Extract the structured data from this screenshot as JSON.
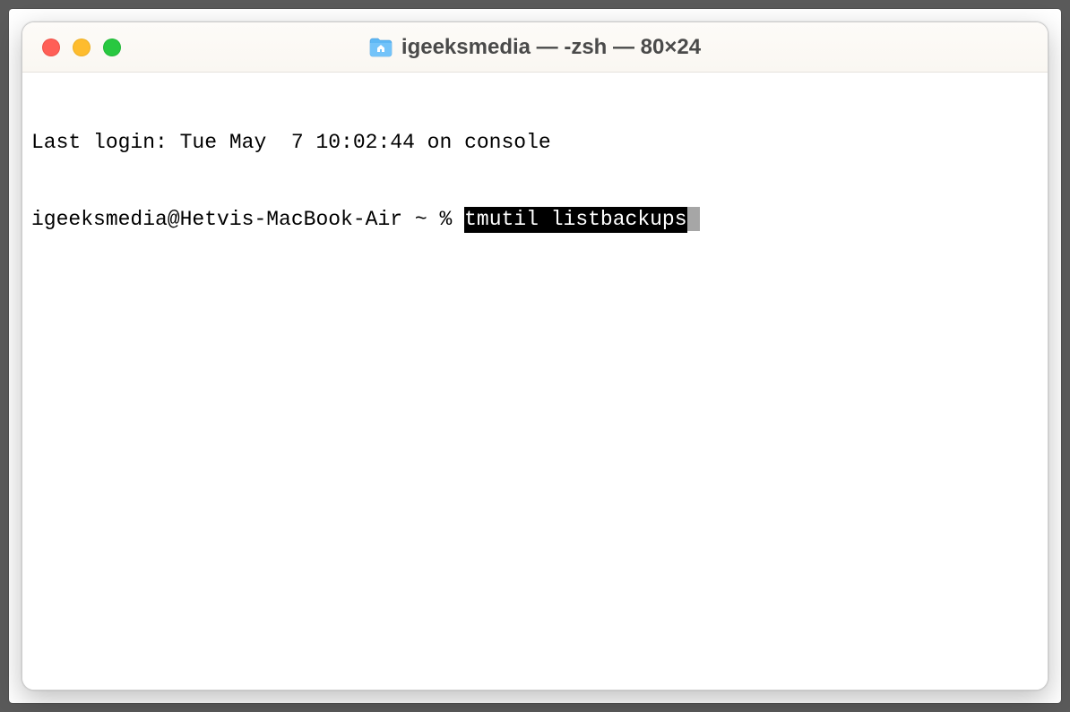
{
  "titlebar": {
    "title": "igeeksmedia — -zsh — 80×24",
    "folder_icon": "home-folder-icon"
  },
  "traffic_lights": {
    "close": "close",
    "minimize": "minimize",
    "maximize": "maximize"
  },
  "terminal": {
    "line1": "Last login: Tue May  7 10:02:44 on console",
    "prompt": "igeeksmedia@Hetvis-MacBook-Air ~ % ",
    "command": "tmutil listbackups"
  }
}
